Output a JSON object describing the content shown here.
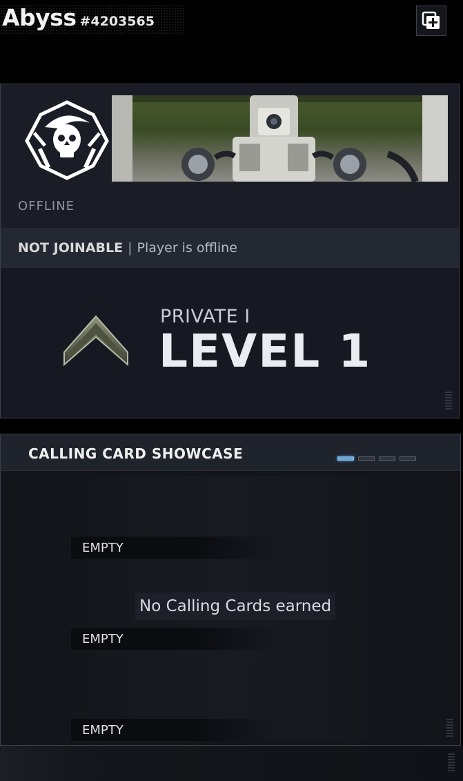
{
  "header": {
    "player_name": "Abyss",
    "player_tag": "#4203565",
    "add_button_icon": "add-to-group-icon"
  },
  "profile": {
    "emblem_icon": "skull-beret-emblem-icon",
    "status": "OFFLINE",
    "joinable_status": "NOT JOINABLE",
    "separator": "|",
    "joinable_detail": "Player is offline",
    "rank": {
      "name": "PRIVATE I",
      "level": "LEVEL 1",
      "icon": "chevron-rank-icon"
    }
  },
  "showcase": {
    "title": "CALLING CARD SHOWCASE",
    "pages": [
      true,
      false,
      false,
      false
    ],
    "slots": [
      "EMPTY",
      "EMPTY",
      "EMPTY"
    ],
    "empty_message": "No Calling Cards earned"
  },
  "colors": {
    "accent": "#6fa7d8",
    "panel": "#1a1d26",
    "row": "#242832"
  }
}
